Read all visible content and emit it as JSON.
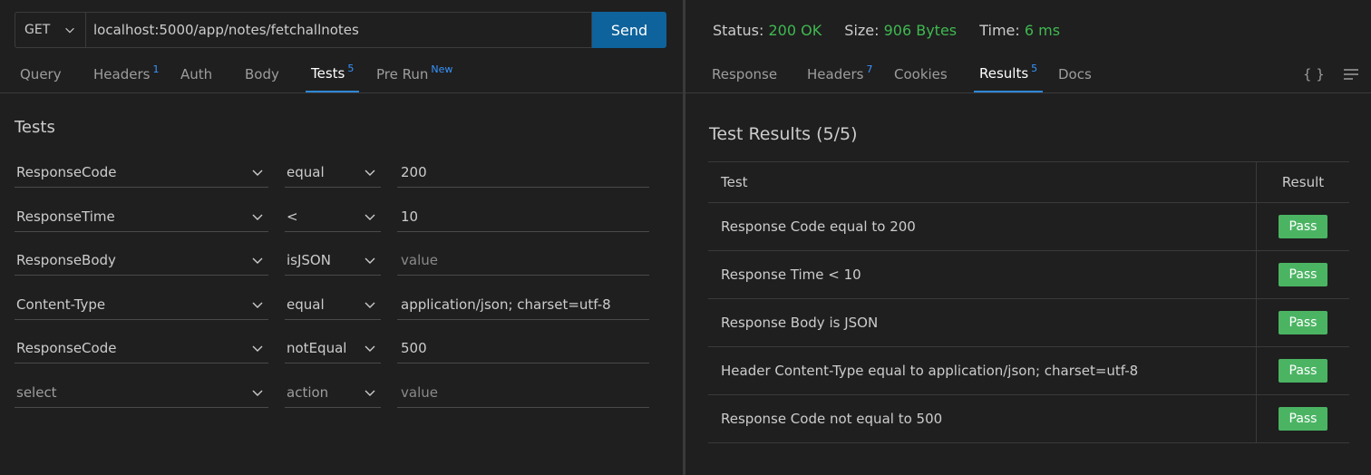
{
  "request": {
    "method": "GET",
    "url": "localhost:5000/app/notes/fetchallnotes",
    "send_label": "Send"
  },
  "left_tabs": [
    {
      "label": "Query",
      "badge": ""
    },
    {
      "label": "Headers",
      "badge": "1"
    },
    {
      "label": "Auth",
      "badge": ""
    },
    {
      "label": "Body",
      "badge": ""
    },
    {
      "label": "Tests",
      "badge": "5"
    },
    {
      "label": "Pre Run",
      "badge": "New"
    }
  ],
  "tests": {
    "title": "Tests",
    "rows": [
      {
        "field": "ResponseCode",
        "action": "equal",
        "value": "200",
        "placeholder": "value"
      },
      {
        "field": "ResponseTime",
        "action": "<",
        "value": "10",
        "placeholder": "value"
      },
      {
        "field": "ResponseBody",
        "action": "isJSON",
        "value": "",
        "placeholder": "value"
      },
      {
        "field": "Content-Type",
        "action": "equal",
        "value": "application/json; charset=utf-8",
        "placeholder": "value"
      },
      {
        "field": "ResponseCode",
        "action": "notEqual",
        "value": "500",
        "placeholder": "value"
      },
      {
        "field": "select",
        "action": "action",
        "value": "",
        "placeholder": "value"
      }
    ]
  },
  "status": {
    "status_label": "Status:",
    "status_value": "200 OK",
    "size_label": "Size:",
    "size_value": "906 Bytes",
    "time_label": "Time:",
    "time_value": "6 ms"
  },
  "right_tabs": [
    {
      "label": "Response",
      "badge": ""
    },
    {
      "label": "Headers",
      "badge": "7"
    },
    {
      "label": "Cookies",
      "badge": ""
    },
    {
      "label": "Results",
      "badge": "5"
    },
    {
      "label": "Docs",
      "badge": ""
    }
  ],
  "right_icons": {
    "format": "{ }",
    "wrap": "wrap-lines-icon"
  },
  "results": {
    "title": "Test Results (5/5)",
    "col_test": "Test",
    "col_result": "Result",
    "rows": [
      {
        "test": "Response Code equal to 200",
        "result": "Pass"
      },
      {
        "test": "Response Time < 10",
        "result": "Pass"
      },
      {
        "test": "Response Body is JSON",
        "result": "Pass"
      },
      {
        "test": "Header Content-Type equal to application/json; charset=utf-8",
        "result": "Pass"
      },
      {
        "test": "Response Code not equal to 500",
        "result": "Pass"
      }
    ]
  },
  "colors": {
    "accent": "#0e639c",
    "pass": "#4bb463",
    "ok_text": "#3fb950",
    "tab_underline": "#2f87d6"
  }
}
